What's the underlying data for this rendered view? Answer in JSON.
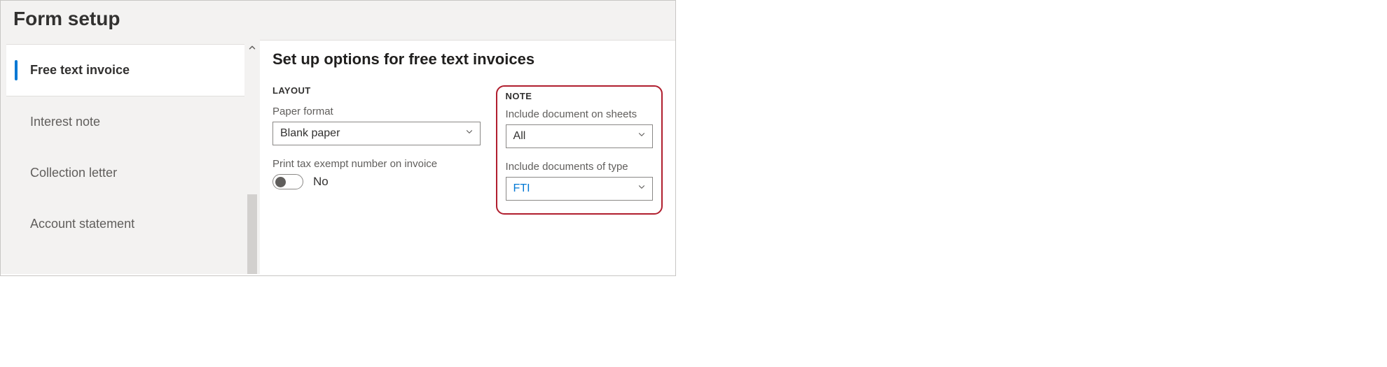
{
  "page": {
    "title": "Form setup"
  },
  "sidebar": {
    "items": [
      {
        "label": "Free text invoice",
        "active": true
      },
      {
        "label": "Interest note",
        "active": false
      },
      {
        "label": "Collection letter",
        "active": false
      },
      {
        "label": "Account statement",
        "active": false
      }
    ]
  },
  "content": {
    "title": "Set up options for free text invoices",
    "layout": {
      "header": "LAYOUT",
      "paper_format": {
        "label": "Paper format",
        "value": "Blank paper"
      },
      "print_tax_exempt": {
        "label": "Print tax exempt number on invoice",
        "value": "No",
        "state": false
      }
    },
    "note": {
      "header": "NOTE",
      "include_on_sheets": {
        "label": "Include document on sheets",
        "value": "All"
      },
      "include_type": {
        "label": "Include documents of type",
        "value": "FTI"
      }
    }
  }
}
